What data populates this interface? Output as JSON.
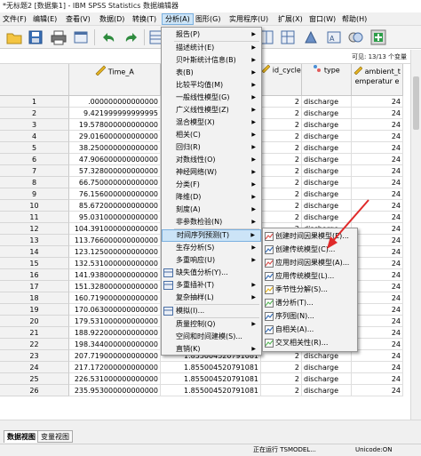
{
  "window": {
    "title": "*无标题2 [数据集1] - IBM SPSS Statistics 数据编辑器"
  },
  "menubar": [
    "文件(F)",
    "编辑(E)",
    "查看(V)",
    "数据(D)",
    "转换(T)",
    "分析(A)",
    "图形(G)",
    "实用程序(U)",
    "扩展(X)",
    "窗口(W)",
    "帮助(H)"
  ],
  "varcount": "可见: 13/13 个变量",
  "columns": {
    "time": "Time_A",
    "id_cycle": "id_cycle",
    "type": "type",
    "ambient": "ambient_t emperatur e"
  },
  "rows": [
    {
      "n": "1",
      "time": ".000000000000000",
      "id": "2",
      "type": "discharge",
      "amb": "24"
    },
    {
      "n": "2",
      "time": "9.421999999999995",
      "id": "2",
      "type": "discharge",
      "amb": "24"
    },
    {
      "n": "3",
      "time": "19.578000000000000",
      "id": "2",
      "type": "discharge",
      "amb": "24"
    },
    {
      "n": "4",
      "time": "29.016000000000000",
      "id": "2",
      "type": "discharge",
      "amb": "24"
    },
    {
      "n": "5",
      "time": "38.250000000000000",
      "id": "2",
      "type": "discharge",
      "amb": "24"
    },
    {
      "n": "6",
      "time": "47.906000000000000",
      "id": "2",
      "type": "discharge",
      "amb": "24"
    },
    {
      "n": "7",
      "time": "57.328000000000000",
      "id": "2",
      "type": "discharge",
      "amb": "24"
    },
    {
      "n": "8",
      "time": "66.750000000000000",
      "id": "2",
      "type": "discharge",
      "amb": "24"
    },
    {
      "n": "9",
      "time": "76.156000000000000",
      "id": "2",
      "type": "discharge",
      "amb": "24"
    },
    {
      "n": "10",
      "time": "85.672000000000000",
      "id": "2",
      "type": "discharge",
      "amb": "24"
    },
    {
      "n": "11",
      "time": "95.031000000000000",
      "id": "2",
      "type": "discharge",
      "amb": "24"
    },
    {
      "n": "12",
      "time": "104.391000000000000",
      "id": "2",
      "type": "discharge",
      "amb": "24"
    },
    {
      "n": "13",
      "time": "113.766000000000000",
      "id": "2",
      "type": "discharge",
      "amb": "24"
    },
    {
      "n": "14",
      "time": "123.125000000000000",
      "id": "2",
      "type": "discharge",
      "amb": "24"
    },
    {
      "n": "15",
      "time": "132.531000000000000",
      "id": "2",
      "type": "discharge",
      "amb": "24"
    },
    {
      "n": "16",
      "time": "141.938000000000000",
      "id": "2",
      "type": "discharge",
      "amb": "24"
    },
    {
      "n": "17",
      "time": "151.328000000000000",
      "id": "2",
      "type": "discharge",
      "amb": "24"
    },
    {
      "n": "18",
      "time": "160.719000000000000",
      "id": "2",
      "type": "discharge",
      "amb": "24"
    },
    {
      "n": "19",
      "time": "170.063000000000000",
      "id": "2",
      "type": "discharge",
      "amb": "24"
    },
    {
      "n": "20",
      "time": "179.531000000000000",
      "id": "2",
      "type": "discharge",
      "amb": "24"
    },
    {
      "n": "21",
      "time": "188.922000000000000",
      "id": "2",
      "type": "discharge",
      "amb": "24"
    },
    {
      "n": "22",
      "time": "198.344000000000000",
      "id": "2",
      "type": "discharge",
      "amb": "24"
    },
    {
      "n": "23",
      "time": "207.719000000000000",
      "val": "1.855004520791081",
      "id": "2",
      "type": "discharge",
      "amb": "24"
    },
    {
      "n": "24",
      "time": "217.172000000000000",
      "val": "1.855004520791081",
      "id": "2",
      "type": "discharge",
      "amb": "24"
    },
    {
      "n": "25",
      "time": "226.531000000000000",
      "val": "1.855004520791081",
      "id": "2",
      "type": "discharge",
      "amb": "24"
    },
    {
      "n": "26",
      "time": "235.953000000000000",
      "val": "1.855004520791081",
      "id": "2",
      "type": "discharge",
      "amb": "24"
    }
  ],
  "analyze_menu": [
    "报告(P)",
    "描述统计(E)",
    "贝叶斯统计信息(B)",
    "表(B)",
    "比较平均值(M)",
    "一般线性模型(G)",
    "广义线性模型(Z)",
    "混合模型(X)",
    "相关(C)",
    "回归(R)",
    "对数线性(O)",
    "神经网络(W)",
    "分类(F)",
    "降维(D)",
    "刻度(A)",
    "非参数检验(N)",
    "时间序列预测(T)",
    "生存分析(S)",
    "多重响应(U)",
    "缺失值分析(Y)...",
    "多重插补(T)",
    "复杂抽样(L)",
    "模拟(I)...",
    "质量控制(Q)",
    "空间和时间建模(S)...",
    "直销(K)"
  ],
  "timeseries_menu": [
    "创建时间因果模型(E)...",
    "创建传统模型(C)...",
    "应用时间因果模型(A)...",
    "应用传统模型(L)...",
    "季节性分解(S)...",
    "谱分析(T)...",
    "序列图(N)...",
    "自相关(A)...",
    "交叉相关性(R)..."
  ],
  "viewtabs": {
    "data": "数据视图",
    "variable": "变量视图"
  },
  "status": {
    "processor": "正在运行 TSMODEL...",
    "unicode": "Unicode:ON"
  },
  "colors": {
    "highlight": "#cce4f7",
    "arrow": "#e02a2a"
  }
}
